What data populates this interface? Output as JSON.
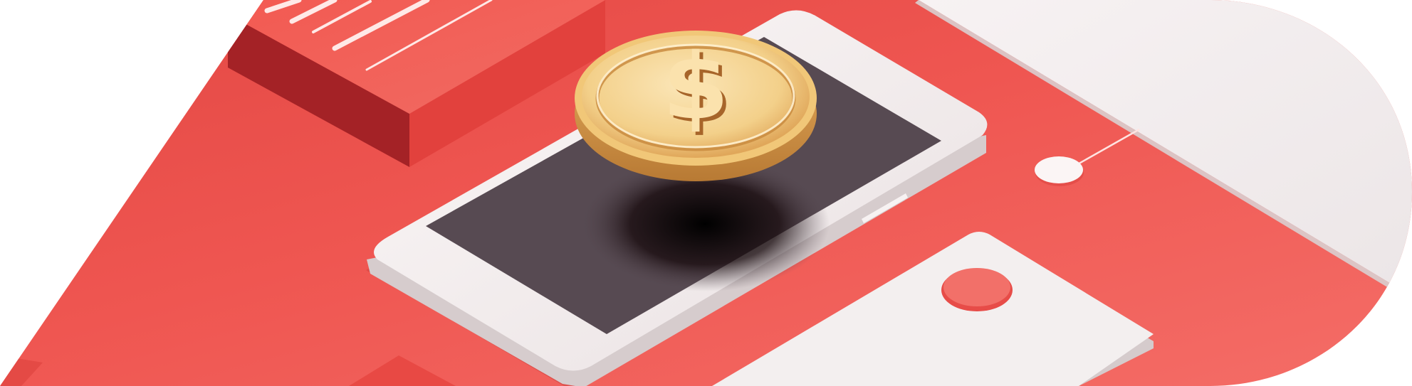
{
  "illustration": {
    "subject": "coin-over-smartphone",
    "symbol": "$",
    "colors": {
      "background": "#ffffff",
      "red": "#ee5450",
      "red_light": "#f47068",
      "red_dark": "#b8302e",
      "gold": "#f2c56a",
      "gold_dark": "#c9893a",
      "phone_body": "#f4eeee",
      "phone_screen": "#574a52",
      "card": "#f2eeef"
    },
    "icons": [
      "dollar-coin-icon",
      "smartphone-icon",
      "bank-card-icon",
      "document-stack-icon"
    ]
  }
}
